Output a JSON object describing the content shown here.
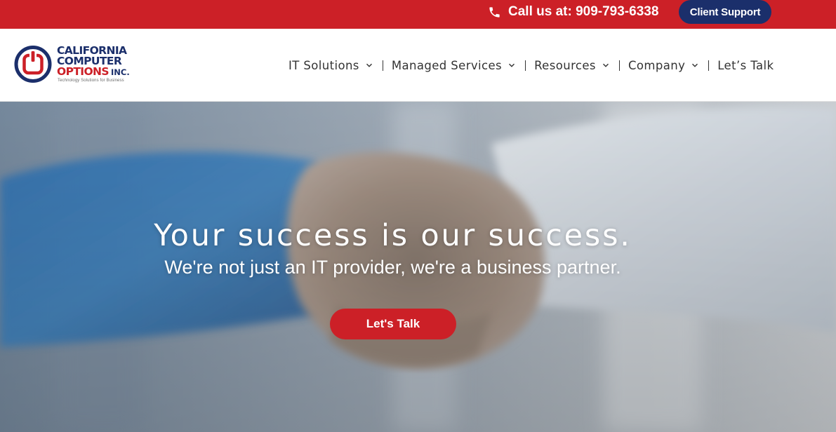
{
  "topbar": {
    "phone_label": "Call us at: 909-793-6338",
    "phone_icon": "phone-icon",
    "support_label": "Client Support",
    "background": "#cc2027",
    "support_background": "#1b2f6b"
  },
  "header": {
    "logo": {
      "line1": "CALIFORNIA",
      "line2": "COMPUTER",
      "line3": "OPTIONS",
      "suffix": "INC.",
      "tagline": "Technology Solutions for Business",
      "brand_blue": "#1b2f6b",
      "brand_red": "#cc2027"
    },
    "nav": [
      {
        "label": "IT Solutions",
        "dropdown": true
      },
      {
        "label": "Managed Services",
        "dropdown": true
      },
      {
        "label": "Resources",
        "dropdown": true
      },
      {
        "label": "Company",
        "dropdown": true
      },
      {
        "label": "Let’s Talk",
        "dropdown": false
      }
    ]
  },
  "hero": {
    "headline": "Your success is our success.",
    "subheadline": "We're not just an IT provider, we're a business partner.",
    "cta_label": "Let's Talk",
    "cta_color": "#cc2027",
    "background_image": "handshake-photo"
  }
}
